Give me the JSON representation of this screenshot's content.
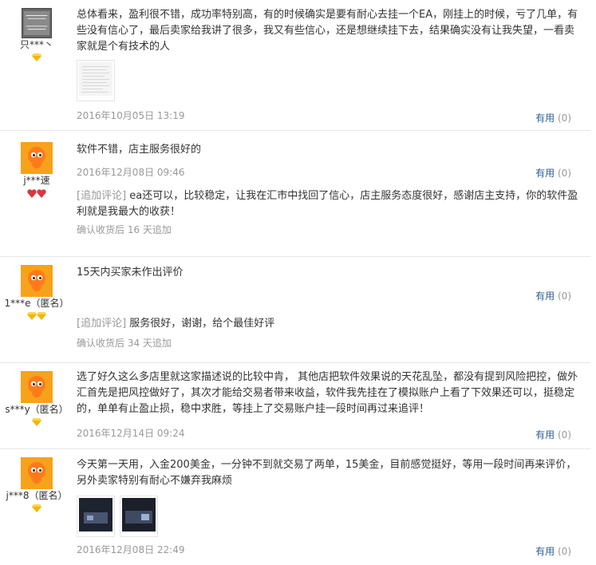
{
  "reviews": [
    {
      "user": "只***丶",
      "avatar_kind": "text-logo",
      "badges": [
        "diamond"
      ],
      "text": "总体看来，盈利很不错，成功率特别高，有的时候确实是要有耐心去挂一个EA，刚挂上的时候，亏了几单，有些没有信心了，最后卖家给我讲了很多，我又有些信心，还是想继续挂下去，结果确实没有让我失望，一看卖家就是个有技术的人",
      "photos": [
        "whitepaper"
      ],
      "date": "2016年10月05日 13:19",
      "useful_label": "有用",
      "useful_count": "(0)"
    },
    {
      "user": "j***速",
      "avatar_kind": "taobao-doll",
      "badges": [
        "heart",
        "heart"
      ],
      "text": "软件不错，店主服务很好的",
      "date": "2016年12月08日 09:46",
      "useful_label": "有用",
      "useful_count": "(0)",
      "followup_tag": "[追加评论]",
      "followup_text": "ea还可以，比较稳定，让我在汇市中找回了信心，店主服务态度很好，感谢店主支持，你的软件盈利就是我最大的收获！",
      "followup_meta": "确认收货后 16 天追加"
    },
    {
      "user": "1***e（匿名）",
      "avatar_kind": "taobao-doll",
      "badges": [
        "diamond",
        "diamond"
      ],
      "text": "15天内买家未作出评价",
      "date": "",
      "useful_label": "有用",
      "useful_count": "(0)",
      "followup_tag": "[追加评论]",
      "followup_text": "服务很好，谢谢，给个最佳好评",
      "followup_meta": "确认收货后 34 天追加"
    },
    {
      "user": "s***y（匿名）",
      "avatar_kind": "taobao-doll",
      "badges": [
        "diamond"
      ],
      "text": "选了好久这么多店里就这家描述说的比较中肯， 其他店把软件效果说的天花乱坠，都没有提到风险把控，做外汇首先是把风控做好了，其次才能给交易者带来收益，软件我先挂在了模拟账户上看了下效果还可以，挺稳定的，单单有止盈止损，稳中求胜，等挂上了交易账户挂一段时间再过来追评！",
      "date": "2016年12月14日 09:24",
      "useful_label": "有用",
      "useful_count": "(0)"
    },
    {
      "user": "j***8（匿名）",
      "avatar_kind": "taobao-doll",
      "badges": [
        "diamond"
      ],
      "text": "今天第一天用，入金200美金，一分钟不到就交易了两单，15美金，目前感觉挺好，等用一段时间再来评价，另外卖家特别有耐心不嫌弃我麻烦",
      "photos": [
        "dark",
        "dark"
      ],
      "date": "2016年12月08日 22:49",
      "useful_label": "有用",
      "useful_count": "(0)"
    }
  ],
  "colors": {
    "link": "#2d5e95",
    "meta": "#999999",
    "text": "#333333",
    "diamond": "#f2b600",
    "heart": "#d9363e",
    "avatar_bg": "#f7a21b"
  }
}
